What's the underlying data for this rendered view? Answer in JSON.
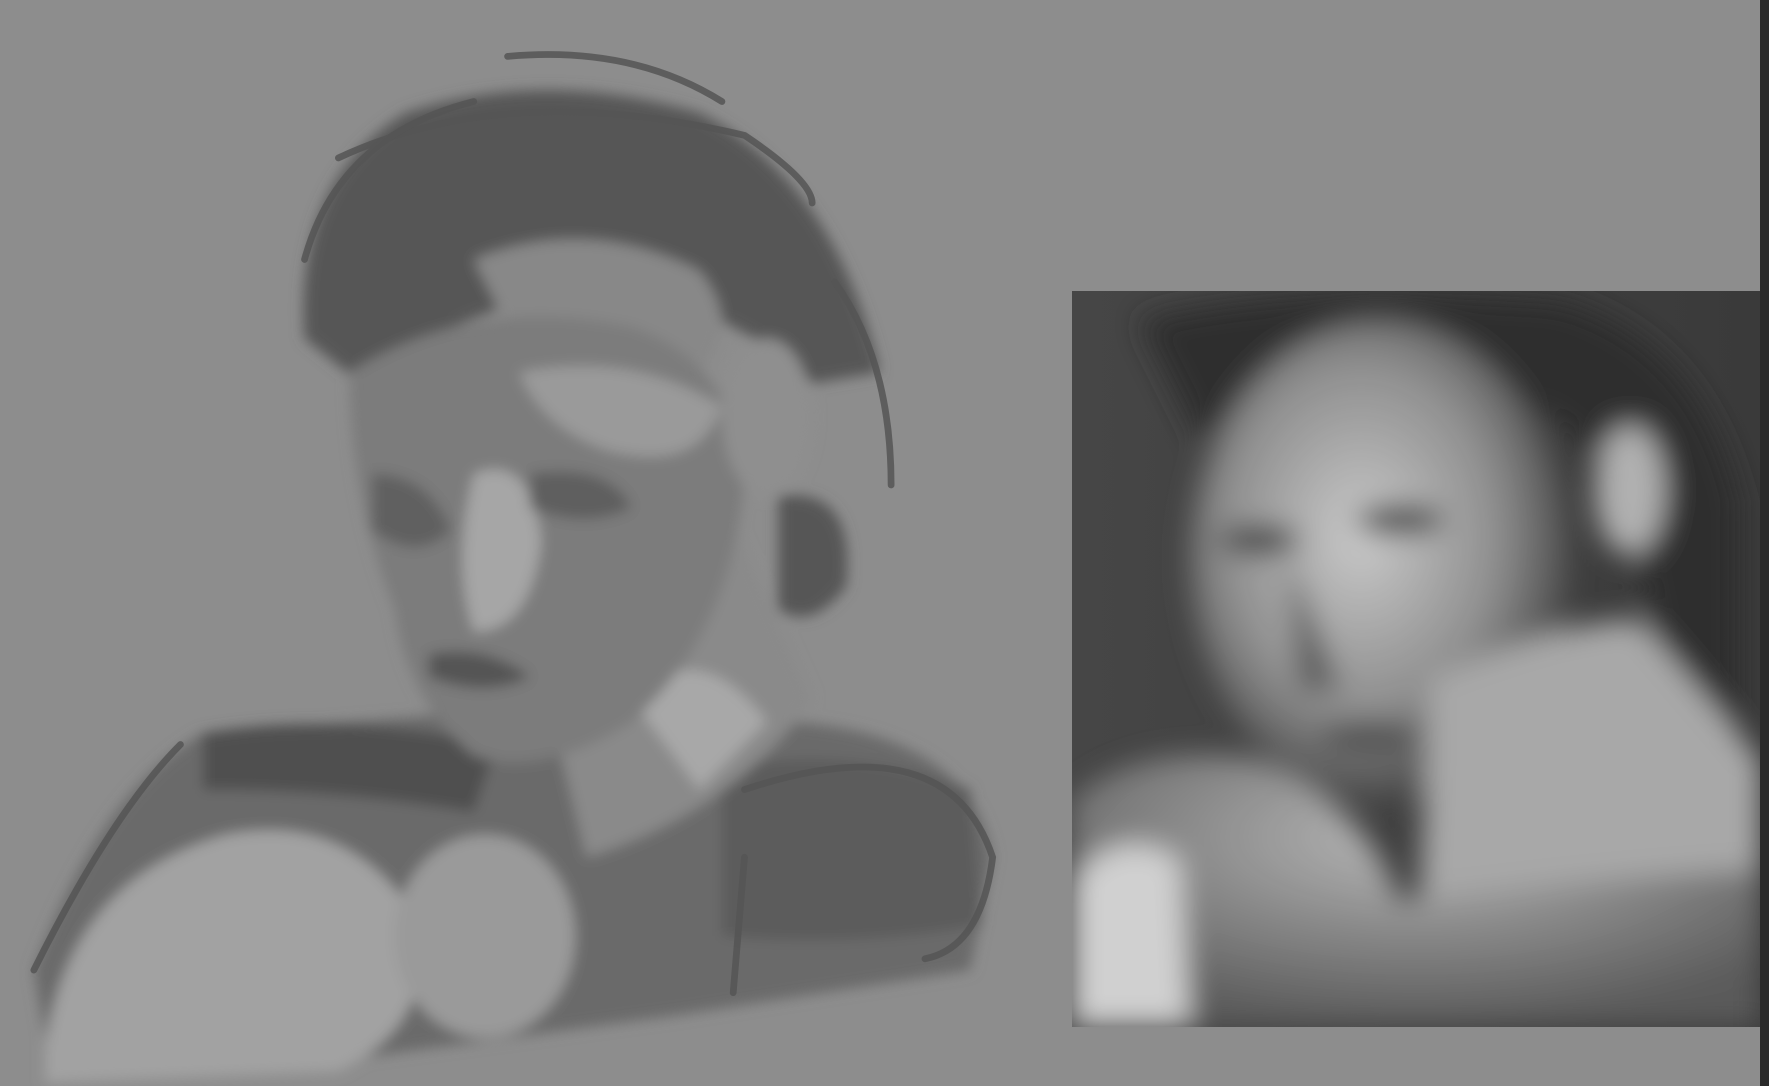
{
  "canvas": {
    "background": "#8d8d8d"
  },
  "panel_edge": {
    "color": "#2a2a2a"
  },
  "artwork": {
    "sketch_tones": [
      "#4f4f4f",
      "#5e5e5e",
      "#6f6f6f",
      "#808080",
      "#9a9a9a",
      "#aaaaaa"
    ],
    "reference_photo_tones": [
      "#2e2e2e",
      "#4a4a4a",
      "#9a9a9a",
      "#c8c8c8"
    ]
  }
}
